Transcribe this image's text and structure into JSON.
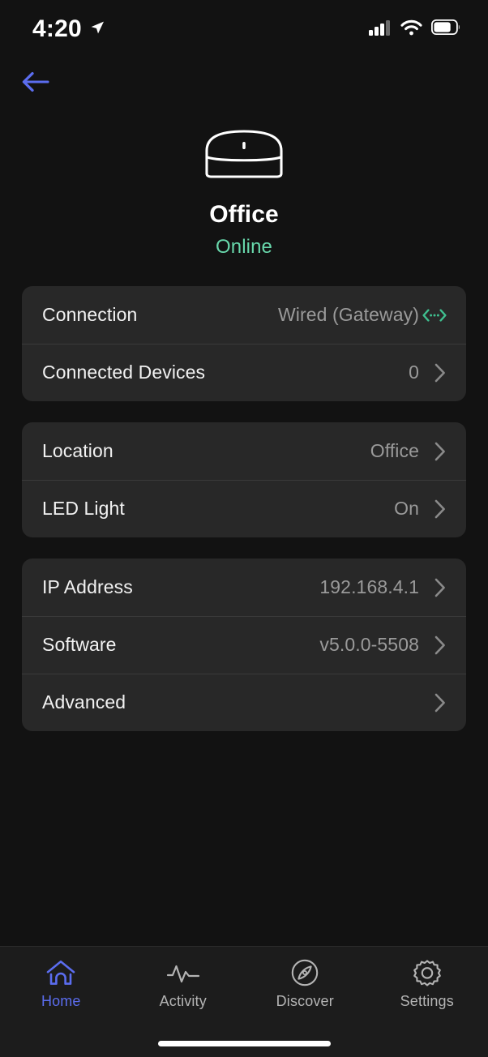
{
  "status_bar": {
    "time": "4:20",
    "location_icon": "location-arrow-icon",
    "cellular_icon": "cellular-signal-icon",
    "wifi_icon": "wifi-icon",
    "battery_icon": "battery-icon",
    "battery_level_percent": 70
  },
  "nav": {
    "back_icon": "back-arrow-icon",
    "back_color": "#5b6def"
  },
  "device": {
    "icon": "eero-router-icon",
    "name": "Office",
    "status": "Online",
    "status_color": "#68d7ab"
  },
  "cards": [
    {
      "rows": [
        {
          "label": "Connection",
          "value": "Wired (Gateway)",
          "accessory": "wired-data-icon",
          "accessory_color": "#3fbf8f"
        },
        {
          "label": "Connected Devices",
          "value": "0",
          "accessory": "chevron-right-icon"
        }
      ]
    },
    {
      "rows": [
        {
          "label": "Location",
          "value": "Office",
          "accessory": "chevron-right-icon"
        },
        {
          "label": "LED Light",
          "value": "On",
          "accessory": "chevron-right-icon"
        }
      ]
    },
    {
      "rows": [
        {
          "label": "IP Address",
          "value": "192.168.4.1",
          "accessory": "chevron-right-icon"
        },
        {
          "label": "Software",
          "value": "v5.0.0-5508",
          "accessory": "chevron-right-icon"
        },
        {
          "label": "Advanced",
          "value": "",
          "accessory": "chevron-right-icon"
        }
      ]
    }
  ],
  "tabbar": {
    "active_color": "#5b6def",
    "inactive_color": "#b4b4b4",
    "items": [
      {
        "label": "Home",
        "icon": "house-icon",
        "active": true
      },
      {
        "label": "Activity",
        "icon": "pulse-icon",
        "active": false
      },
      {
        "label": "Discover",
        "icon": "compass-icon",
        "active": false
      },
      {
        "label": "Settings",
        "icon": "gear-icon",
        "active": false
      }
    ]
  },
  "colors": {
    "page_background": "#121212",
    "card_background": "#282828",
    "divider": "#3a3a3a",
    "tabbar_background": "#1c1c1c",
    "primary_text": "#f2f2f2",
    "secondary_text": "#9a9a9a"
  }
}
